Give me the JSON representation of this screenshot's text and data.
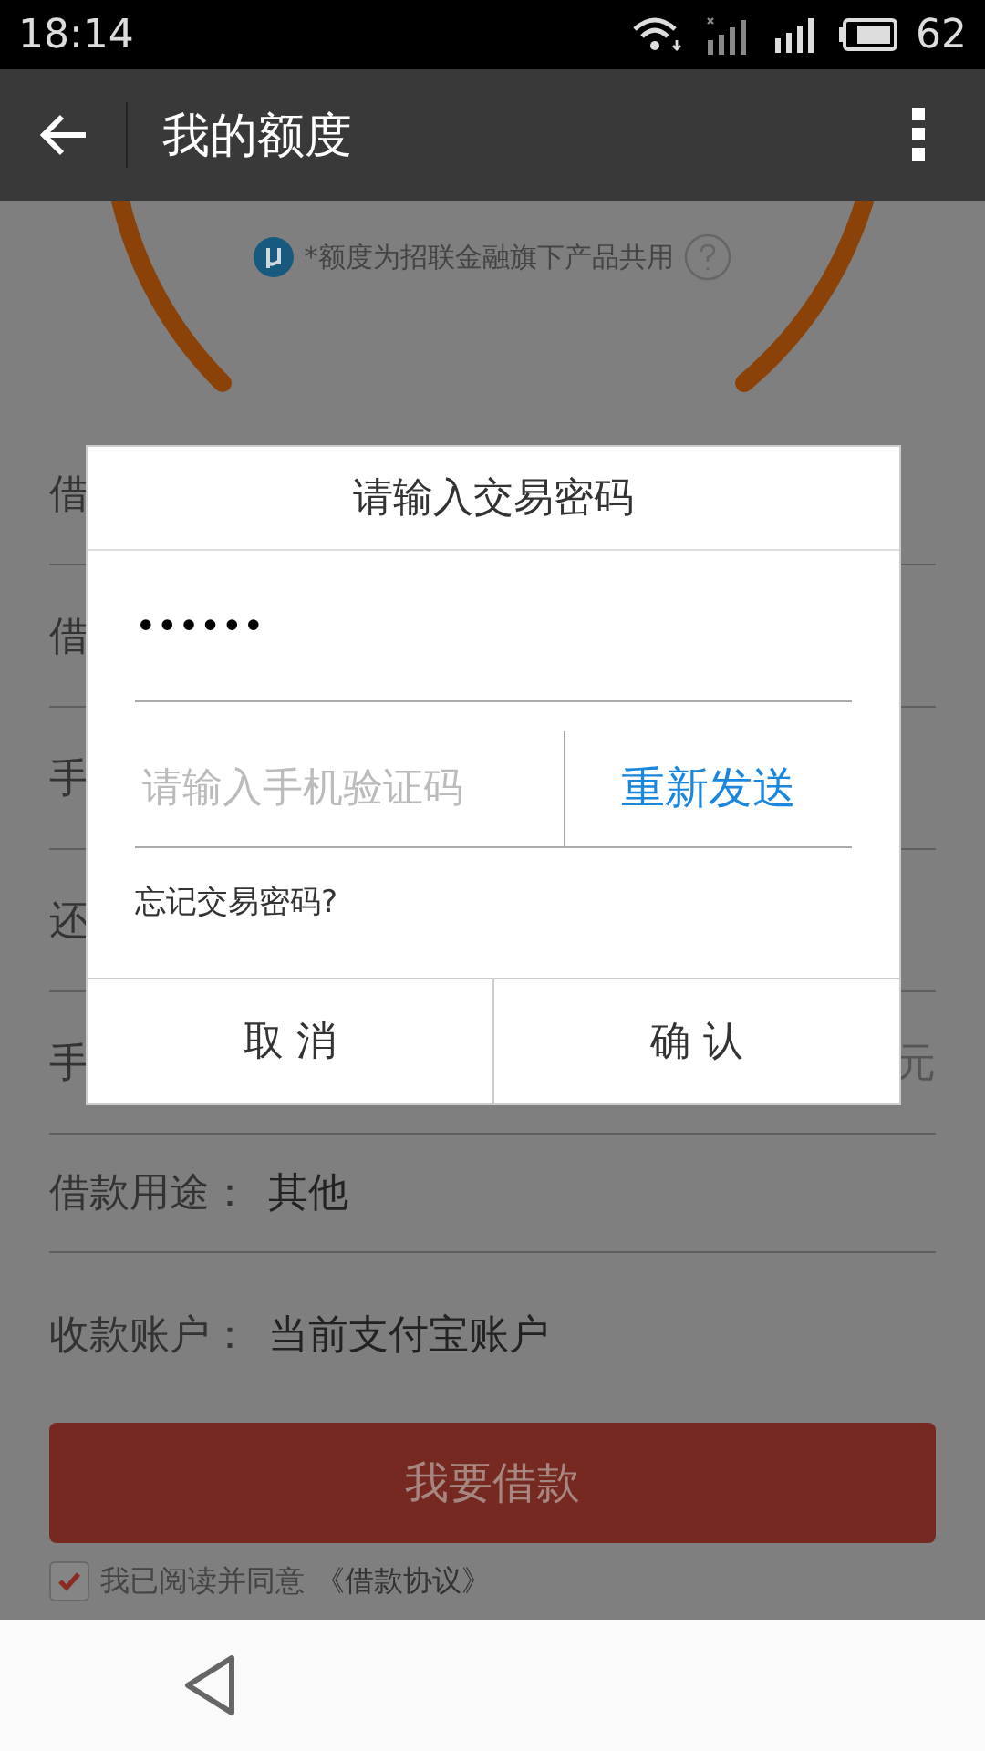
{
  "status_bar": {
    "time": "18:14",
    "battery": "62"
  },
  "app_bar": {
    "title": "我的额度"
  },
  "quota_note": "*额度为招联金融旗下产品共用",
  "form_rows": [
    {
      "label": "借"
    },
    {
      "label": "借"
    },
    {
      "label": "手"
    },
    {
      "label": "还"
    },
    {
      "label": "手",
      "trailing": "元"
    },
    {
      "label": "借款用途：",
      "value": "其他"
    },
    {
      "label": "收款账户：",
      "value": "当前支付宝账户"
    }
  ],
  "borrow_button": "我要借款",
  "agreement": {
    "checked": true,
    "text": "我已阅读并同意",
    "link": "《借款协议》"
  },
  "dialog": {
    "title": "请输入交易密码",
    "password": "••••••",
    "code_placeholder": "请输入手机验证码",
    "resend": "重新发送",
    "forgot": "忘记交易密码?",
    "buttons": [
      "取 消",
      "确 认"
    ]
  }
}
